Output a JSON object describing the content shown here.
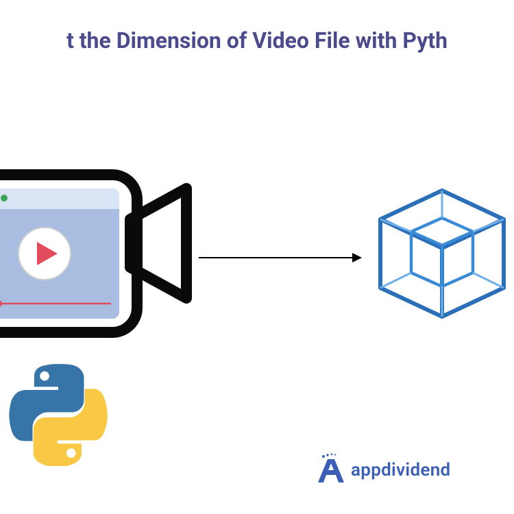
{
  "title": "t the Dimension of Video File with Pyth",
  "brand": {
    "name": "appdividend"
  },
  "colors": {
    "title": "#4a4a8c",
    "camera_stroke": "#0a0a0a",
    "window_fill": "#a8bde0",
    "window_top": "#d9e4f5",
    "play_fill": "#e24b5b",
    "cube_outer": "#2b6fb8",
    "cube_inner": "#3a8ad6",
    "python_blue": "#3774a7",
    "python_yellow": "#f9c946",
    "brand_blue": "#3a5fb5"
  },
  "icons": {
    "camera": "camera",
    "wire_cube": "wireframe-cube",
    "python": "python-logo",
    "brand_mark": "letter-a-with-dots",
    "arrow": "right-arrow"
  }
}
